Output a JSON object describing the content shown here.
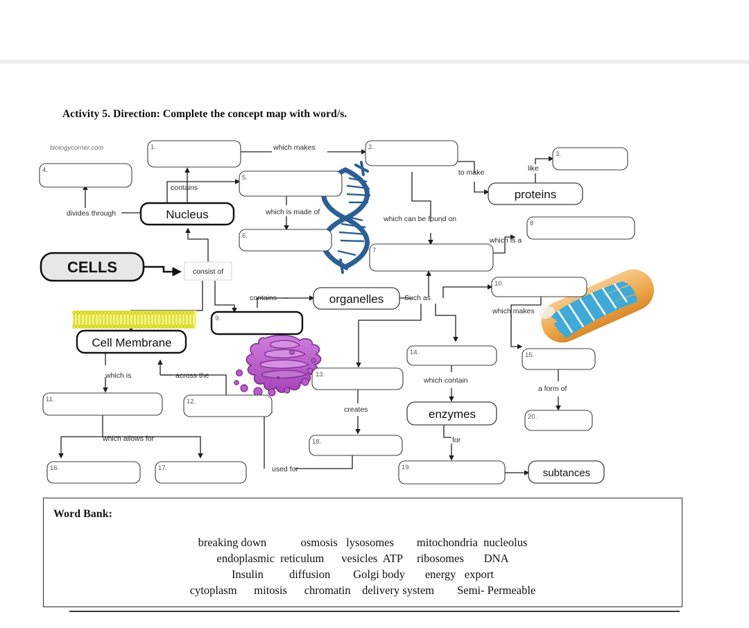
{
  "document": {
    "activity_title": "Activity 5. Direction: Complete the concept map with word/s.",
    "watermark": "biologycorner.com",
    "bottom_ghost_text": ""
  },
  "concept_map": {
    "filled_boxes": [
      {
        "id": "nucleus",
        "label": "Nucleus"
      },
      {
        "id": "cells",
        "label": "CELLS"
      },
      {
        "id": "cell-membrane",
        "label": "Cell Membrane"
      },
      {
        "id": "proteins",
        "label": "proteins"
      },
      {
        "id": "organelles",
        "label": "organelles"
      },
      {
        "id": "enzymes",
        "label": "enzymes"
      },
      {
        "id": "subtances",
        "label": "subtances"
      }
    ],
    "blank_boxes": [
      {
        "num": "1.",
        "answer": ""
      },
      {
        "num": "2.",
        "answer": ""
      },
      {
        "num": "3.",
        "answer": ""
      },
      {
        "num": "4.",
        "answer": ""
      },
      {
        "num": "5.",
        "answer": ""
      },
      {
        "num": "6.",
        "answer": ""
      },
      {
        "num": "7",
        "answer": ""
      },
      {
        "num": "8",
        "answer": ""
      },
      {
        "num": "9.",
        "answer": ""
      },
      {
        "num": "10.",
        "answer": ""
      },
      {
        "num": "11.",
        "answer": ""
      },
      {
        "num": "12.",
        "answer": ""
      },
      {
        "num": "13.",
        "answer": ""
      },
      {
        "num": "14.",
        "answer": ""
      },
      {
        "num": "15.",
        "answer": ""
      },
      {
        "num": "16.",
        "answer": ""
      },
      {
        "num": "17.",
        "answer": ""
      },
      {
        "num": "18.",
        "answer": ""
      },
      {
        "num": "19.",
        "answer": ""
      },
      {
        "num": "20.",
        "answer": ""
      }
    ],
    "connector_labels": [
      {
        "id": "which-makes-1",
        "text": "which makes"
      },
      {
        "id": "contains-nucleus",
        "text": "contains"
      },
      {
        "id": "divides-through",
        "text": "divides through"
      },
      {
        "id": "which-is-made-of",
        "text": "which is made of"
      },
      {
        "id": "to-make",
        "text": "to make"
      },
      {
        "id": "like",
        "text": "like"
      },
      {
        "id": "which-can-be-found-on",
        "text": "which can be found on"
      },
      {
        "id": "which-is-a",
        "text": "which is a"
      },
      {
        "id": "consist-of",
        "text": "consist of"
      },
      {
        "id": "contains-organelles",
        "text": "contains"
      },
      {
        "id": "such-as",
        "text": "Such as"
      },
      {
        "id": "which-makes-10",
        "text": "which makes"
      },
      {
        "id": "which-contain",
        "text": "which contain"
      },
      {
        "id": "a-form-of",
        "text": "a form of"
      },
      {
        "id": "which-is",
        "text": "which is"
      },
      {
        "id": "across-the",
        "text": "across the"
      },
      {
        "id": "which-allows-for",
        "text": "which allows for"
      },
      {
        "id": "creates",
        "text": "creates"
      },
      {
        "id": "used-for",
        "text": "used for"
      },
      {
        "id": "for",
        "text": "for"
      }
    ],
    "illustrations": [
      {
        "id": "dna-helix",
        "name": "DNA double helix",
        "color": "#2c5f95"
      },
      {
        "id": "phospholipid",
        "name": "Phospholipid bilayer",
        "color": "#e8e832"
      },
      {
        "id": "golgi-body",
        "name": "Golgi body",
        "color": "#b85cc4"
      },
      {
        "id": "mitochondrion",
        "name": "Mitochondrion",
        "color": "#eda24a"
      }
    ]
  },
  "word_bank": {
    "title": "Word Bank:",
    "rows": [
      "breaking down            osmosis   lysosomes        mitochondria  nucleolus",
      "endoplasmic  reticulum      vesicles  ATP     ribosomes       DNA",
      "Insulin         diffusion        Golgi body       energy   export",
      "cytoplasm      mitosis      chromatin    delivery system        Semi- Permeable"
    ],
    "words": [
      "breaking down",
      "osmosis",
      "lysosomes",
      "mitochondria",
      "nucleolus",
      "endoplasmic",
      "reticulum",
      "vesicles",
      "ATP",
      "ribosomes",
      "DNA",
      "Insulin",
      "diffusion",
      "Golgi body",
      "energy",
      "export",
      "cytoplasm",
      "mitosis",
      "chromatin",
      "delivery system",
      "Semi- Permeable"
    ]
  }
}
